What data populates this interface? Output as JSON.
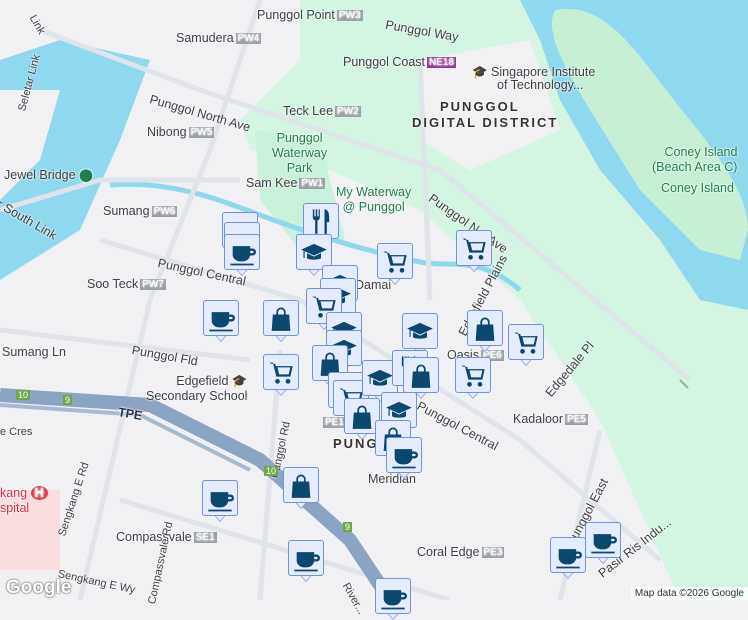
{
  "map": {
    "labels": {
      "punggol_point": "Punggol Point",
      "pw3": "PW3",
      "punggol_way": "Punggol Way",
      "samudera": "Samudera",
      "pw4": "PW4",
      "punggol_coast": "Punggol Coast",
      "ne18": "NE18",
      "sit": "Singapore Institute",
      "sit2": "of Technology...",
      "punggol_north_ave": "Punggol North Ave",
      "teck_lee": "Teck Lee",
      "pw2": "PW2",
      "district1": "PUNGGOL",
      "district2": "DIGITAL DISTRICT",
      "nibong": "Nibong",
      "pw5": "PW5",
      "waterway_park1": "Punggol",
      "waterway_park2": "Waterway",
      "waterway_park3": "Park",
      "jewel_bridge": "Jewel Bridge",
      "sam_kee": "Sam Kee",
      "pw1": "PW1",
      "my_waterway1": "My Waterway",
      "my_waterway2": "@ Punggol",
      "coney_beach1": "Coney Island",
      "coney_beach2": "(Beach Area C)",
      "coney_island": "Coney Island",
      "sumang": "Sumang",
      "pw6": "PW6",
      "punggol_ne_ave": "Punggol N... Ave",
      "punggol_central_w": "Punggol Central",
      "soo_teck": "Soo Teck",
      "pw7": "PW7",
      "damai": "Damai",
      "edgefield_plains": "Edgefield Plains",
      "punggol_fld": "Punggol Fld",
      "sumang_ln": "Sumang Ln",
      "oasis": "Oasis",
      "pe6": "PE6",
      "edgedale_pl": "Edgedale Pl",
      "edgefield_sec1": "Edgefield",
      "edgefield_sec2": "Secondary School",
      "tpe": "TPE",
      "punggol_central_e": "Punggol Central",
      "kadaloor": "Kadaloor",
      "pe5": "PE5",
      "pe1": "PE1",
      "punggol_town": "PUNGGOL",
      "cres": "e Cres",
      "sengkang_e_rd": "Sengkang E Rd",
      "punggol_rd": "Punggol Rd",
      "hospital1": "kang",
      "hospital2": "spital",
      "meridian": "Meridian",
      "punggol_east": "Punggol East",
      "compassvale": "Compassvale",
      "se1": "SE1",
      "coral_edge": "Coral Edge",
      "pe3": "PE3",
      "pasir_ris": "Pasir Ris Indu...",
      "sengkang_e_wy": "Sengkang E Wy",
      "compassvale_rd": "Compassvale Rd",
      "rivervale": "River...",
      "seletar_link": "Seletar Link",
      "south_link": "r South Link",
      "link": "Link",
      "route10a": "10",
      "route9a": "9",
      "route10b": "10",
      "route9b": "9"
    },
    "markers": [
      "fork-knife",
      "coffee",
      "coffee",
      "coffee",
      "graduation-cap",
      "cart",
      "cart",
      "graduation-cap",
      "graduation-cap",
      "cart",
      "coffee",
      "bag",
      "graduation-cap",
      "graduation-cap",
      "graduation-cap",
      "bag",
      "cart",
      "bag",
      "cart",
      "cart",
      "cart",
      "graduation-cap",
      "fork-knife",
      "bag",
      "cart",
      "bag",
      "graduation-cap",
      "bag",
      "coffee",
      "coffee",
      "bag",
      "coffee",
      "coffee",
      "coffee",
      "coffee"
    ],
    "colors": {
      "water": "#8fd9ee",
      "park": "#c9f2da",
      "land": "#f1f1f4",
      "highway": "#8aa4c2",
      "marker_fill": "#e4ecfd",
      "marker_icon": "#0b4870"
    }
  },
  "footer": {
    "google": "Google",
    "attribution": "Map data ©2026 Google"
  }
}
